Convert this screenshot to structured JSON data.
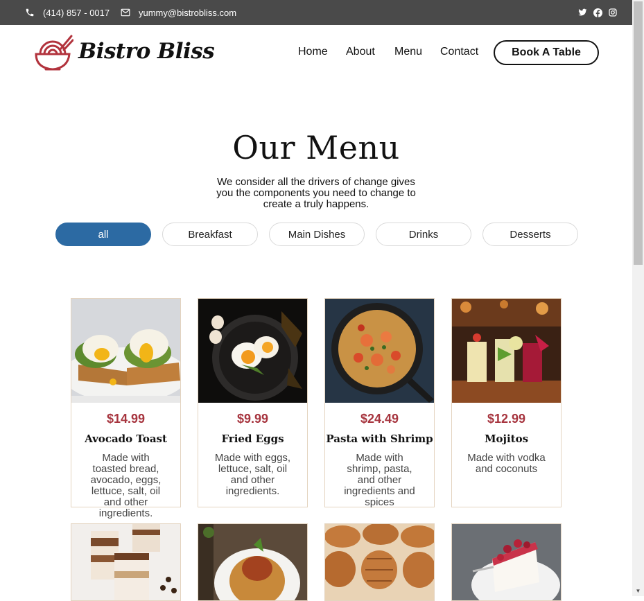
{
  "topbar": {
    "phone": "(414) 857 - 0017",
    "email": "yummy@bistrobliss.com",
    "social": [
      "twitter-icon",
      "facebook-icon",
      "instagram-icon"
    ]
  },
  "header": {
    "brand": "Bistro Bliss",
    "nav": [
      "Home",
      "About",
      "Menu",
      "Contact"
    ],
    "cta": "Book A Table"
  },
  "menu": {
    "title": "Our Menu",
    "subtitle": "We consider all the drivers of change gives you the components you need to change to create a truly happens.",
    "filters": [
      "all",
      "Breakfast",
      "Main Dishes",
      "Drinks",
      "Desserts"
    ],
    "active_filter": "all",
    "items": [
      {
        "price": "$14.99",
        "name": "Avocado Toast",
        "desc": "Made with toasted bread, avocado, eggs, lettuce, salt, oil and other ingredients."
      },
      {
        "price": "$9.99",
        "name": "Fried Eggs",
        "desc": "Made with eggs, lettuce, salt, oil and other ingredients."
      },
      {
        "price": "$24.49",
        "name": "Pasta with Shrimp",
        "desc": "Made with shrimp, pasta, and other ingredients and spices"
      },
      {
        "price": "$12.99",
        "name": "Mojitos",
        "desc": "Made with vodka and coconuts"
      }
    ],
    "second_row": [
      "tiramisu-photo",
      "spaghetti-photo",
      "croissants-photo",
      "cheesecake-photo"
    ]
  },
  "colors": {
    "accent": "#2c6aa3",
    "price": "#a7353f",
    "brand_icon": "#b2333d",
    "topbar": "#4a4a4a"
  }
}
